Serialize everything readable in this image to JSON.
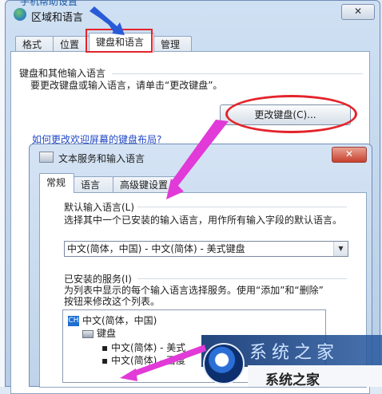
{
  "background": {
    "title_fragment": "手机帮助设置"
  },
  "outer_dialog": {
    "title": "区域和语言",
    "close_label": "✕",
    "tabs": [
      {
        "label": "格式"
      },
      {
        "label": "位置"
      },
      {
        "label": "键盘和语言"
      },
      {
        "label": "管理"
      }
    ],
    "group_label": "键盘和其他输入语言",
    "help_text": "要更改键盘或输入语言，请单击“更改键盘”。",
    "change_keyboard_button": "更改键盘(C)...",
    "link_text": "如何更改欢迎屏幕的键盘布局?"
  },
  "inner_dialog": {
    "title": "文本服务和输入语言",
    "close_label": "✕",
    "tabs": [
      {
        "label": "常规"
      },
      {
        "label": "语言栏"
      },
      {
        "label": "高级键设置"
      }
    ],
    "default_lang_label": "默认输入语言(L)",
    "default_lang_desc": "选择其中一个已安装的输入语言，用作所有输入字段的默认语言。",
    "default_lang_value": "中文(简体，中国) - 中文(简体) - 美式键盘",
    "installed_label": "已安装的服务(I)",
    "installed_desc1": "为列表中显示的每个输入语言选择服务。使用“添加”和“删除”",
    "installed_desc2": "按钮来修改这个列表。",
    "tree": {
      "lang_badge": "CH",
      "lang": "中文(简体，中国)",
      "keyboard": "键盘",
      "item1": "▪  中文(简体) - 美式",
      "item2": "▪  中文(简体) - 百度"
    }
  },
  "watermark": {
    "top_chars": "系统之家",
    "text": "系统之家"
  },
  "colors": {
    "annotation_red": "#e3242b",
    "arrow_magenta": "#e13ad8",
    "arrow_blue": "#2a5bd7",
    "link_blue": "#1f47c5"
  }
}
